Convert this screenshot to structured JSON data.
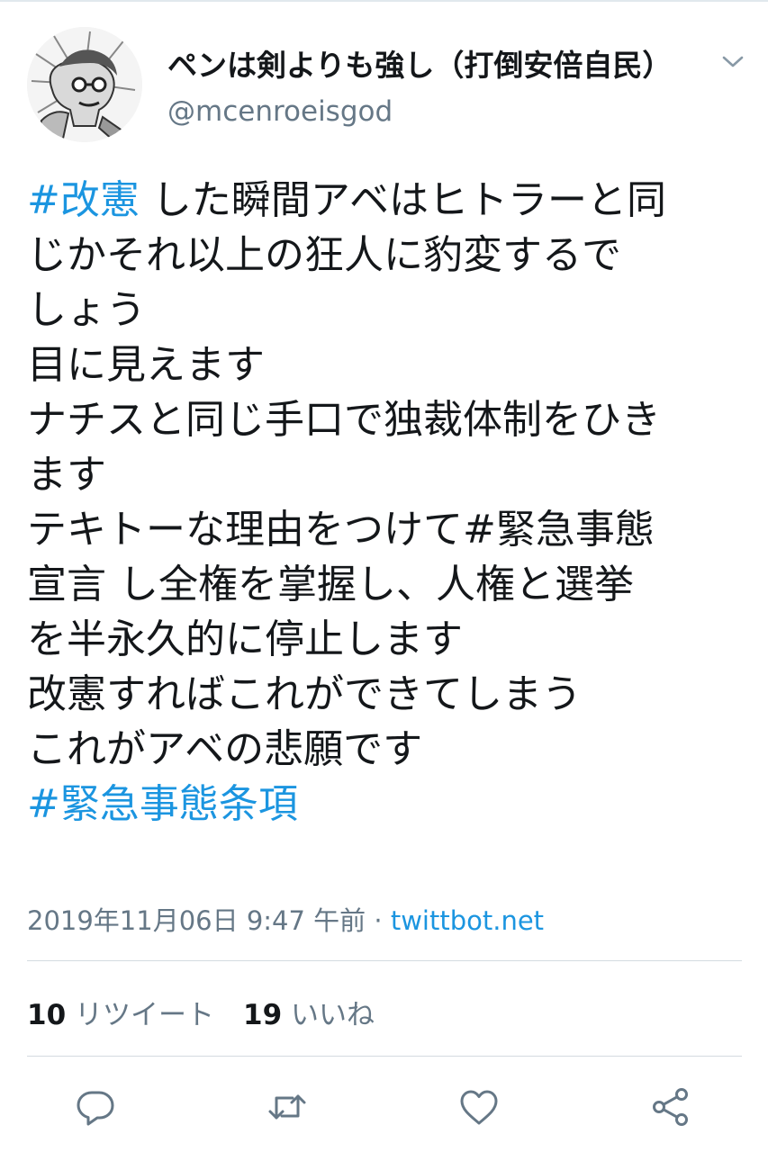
{
  "user": {
    "display_name": "ペンは剣よりも強し（打倒安倍自民）",
    "handle": "@mcenroeisgod",
    "avatar_icon": "manga-portrait-avatar"
  },
  "tweet": {
    "lines": [
      [
        {
          "text": "#改憲",
          "hashtag": true
        },
        {
          "text": " した瞬間アベはヒトラーと同",
          "hashtag": false
        }
      ],
      [
        {
          "text": "じかそれ以上の狂人に豹変するで",
          "hashtag": false
        }
      ],
      [
        {
          "text": "しょう",
          "hashtag": false
        }
      ],
      [
        {
          "text": "目に見えます",
          "hashtag": false
        }
      ],
      [
        {
          "text": "ナチスと同じ手口で独裁体制をひき",
          "hashtag": false
        }
      ],
      [
        {
          "text": "ます",
          "hashtag": false
        }
      ],
      [
        {
          "text": "テキトーな理由をつけて#緊急事態",
          "hashtag": false
        }
      ],
      [
        {
          "text": "宣言 し全権を掌握し、人権と選挙",
          "hashtag": false
        }
      ],
      [
        {
          "text": "を半永久的に停止します",
          "hashtag": false
        }
      ],
      [
        {
          "text": "改憲すればこれができてしまう",
          "hashtag": false
        }
      ],
      [
        {
          "text": "これがアベの悲願です",
          "hashtag": false
        }
      ],
      [
        {
          "text": "#緊急事態条項",
          "hashtag": true
        }
      ]
    ],
    "timestamp": "2019年11月06日 9:47 午前",
    "separator": " · ",
    "source": "twittbot.net"
  },
  "stats": {
    "retweets_count": "10",
    "retweets_label": " リツイート",
    "likes_count": "19",
    "likes_label": " いいね"
  },
  "actions": [
    "reply-icon",
    "retweet-icon",
    "like-icon",
    "share-icon"
  ],
  "colors": {
    "link": "#1b95e0",
    "muted": "#657786",
    "text": "#14171a",
    "divider": "#d4dbe0"
  }
}
